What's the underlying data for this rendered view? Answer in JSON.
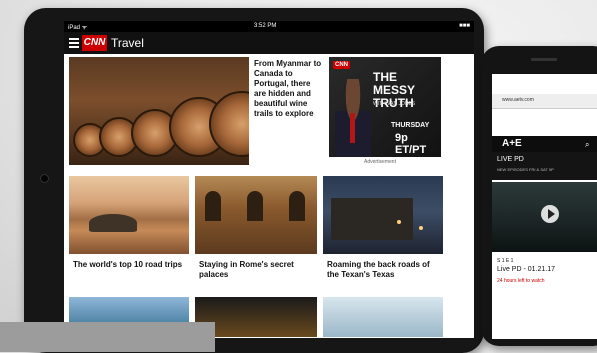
{
  "tablet": {
    "statusbar": {
      "carrier": "iPad ᯤ",
      "time": "3:52 PM",
      "battery": "■■■"
    },
    "appbar": {
      "logo": "CNN",
      "section": "Travel"
    },
    "hero": {
      "text": "From Myanmar to Canada to Portugal, there are hidden and beautiful wine trails to explore"
    },
    "ad": {
      "brand": "CNN",
      "title": "THE MESSY TRUTH",
      "subtitle": "WITH VAN JONES",
      "day": "THURSDAY",
      "time": "9p ET/PT",
      "label": "Advertisement"
    },
    "cards": [
      {
        "title": "The world's top 10 road trips",
        "icon": "beach-image"
      },
      {
        "title": "Staying in Rome's secret palaces",
        "icon": "palace-image"
      },
      {
        "title": "Roaming the back roads of the Texan's Texas",
        "icon": "texas-image"
      }
    ]
  },
  "phone": {
    "url": "www.aetv.com",
    "logo": "A+E",
    "show": "LIVE PD",
    "show_sub": "NEW EPISODES FRI & SAT 9P",
    "episode_num": "S 1 E 1",
    "episode_title": "Live PD - 01.21.17",
    "warning": "24 hours left to watch"
  },
  "colors": {
    "cnn_red": "#cc0000",
    "dark": "#161616"
  }
}
